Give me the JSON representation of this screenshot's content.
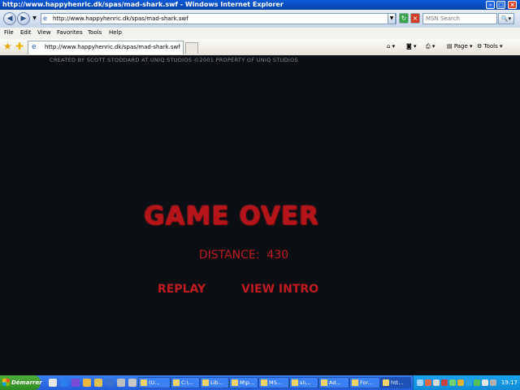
{
  "window": {
    "title": "http://www.happyhenric.dk/spas/mad-shark.swf - Windows Internet Explorer"
  },
  "address_bar": {
    "url": "http://www.happyhenric.dk/spas/mad-shark.swf",
    "search_placeholder": "MSN Search"
  },
  "menu": [
    "File",
    "Edit",
    "View",
    "Favorites",
    "Tools",
    "Help"
  ],
  "tab": {
    "title": "http://www.happyhenric.dk/spas/mad-shark.swf"
  },
  "toolbar": {
    "page_label": "Page",
    "tools_label": "Tools"
  },
  "game": {
    "credit": "CREATED BY SCOTT STODDARD AT UNIQ STUDIOS ©2001 PROPERTY OF UNIQ STUDIOS",
    "title": "GAME OVER",
    "distance_label": "DISTANCE:",
    "distance_value": "430",
    "replay_label": "REPLAY",
    "intro_label": "VIEW INTRO",
    "accent_color": "#c01b20"
  },
  "taskbar": {
    "start_label": "Démarrer",
    "tasks": [
      "(U...",
      "C:\\...",
      "Lib...",
      "M\\p...",
      "MS...",
      "si\\...",
      "Ad...",
      "For...",
      "htt..."
    ],
    "clock": "19:17"
  }
}
